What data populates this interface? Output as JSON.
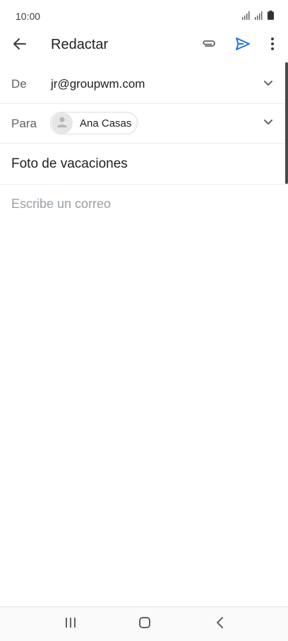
{
  "status_bar": {
    "time": "10:00",
    "icons": [
      "signal-icon",
      "signal-icon",
      "battery-icon"
    ]
  },
  "app_bar": {
    "title": "Redactar",
    "icons": [
      "back-arrow-icon",
      "paperclip-icon",
      "send-icon",
      "more-vert-icon"
    ],
    "accent_color": "#1a73e8"
  },
  "from": {
    "label": "De",
    "value": "jr@groupwm.com"
  },
  "to": {
    "label": "Para",
    "recipient_name": "Ana Casas"
  },
  "subject": "Foto de vacaciones",
  "body": {
    "placeholder": "Escribe un correo"
  },
  "nav_bar": {
    "icons": [
      "recent-apps-icon",
      "home-icon",
      "back-icon"
    ]
  }
}
